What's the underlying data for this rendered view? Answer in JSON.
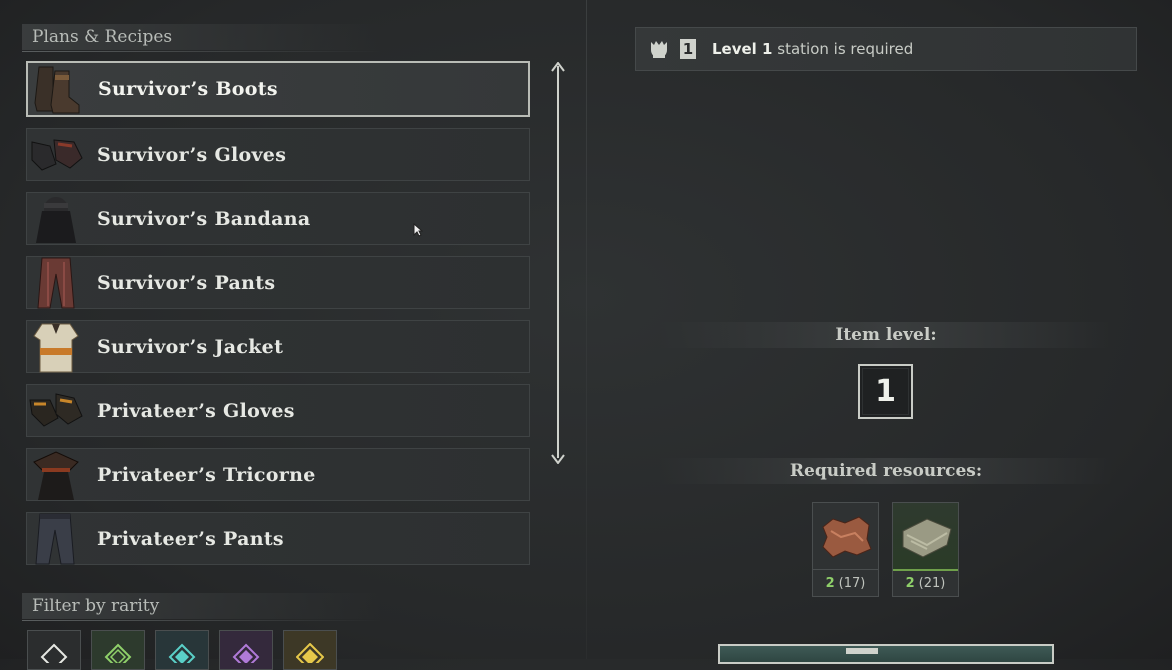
{
  "left_panel": {
    "plans_header": "Plans & Recipes",
    "recipes": [
      {
        "label": "Survivor’s Boots",
        "selected": true,
        "icon": "boots-icon"
      },
      {
        "label": "Survivor’s Gloves",
        "selected": false,
        "icon": "gloves-icon"
      },
      {
        "label": "Survivor’s Bandana",
        "selected": false,
        "icon": "bandana-icon"
      },
      {
        "label": "Survivor’s Pants",
        "selected": false,
        "icon": "pants-icon"
      },
      {
        "label": "Survivor’s Jacket",
        "selected": false,
        "icon": "jacket-icon"
      },
      {
        "label": "Privateer’s Gloves",
        "selected": false,
        "icon": "gloves-icon"
      },
      {
        "label": "Privateer’s Tricorne",
        "selected": false,
        "icon": "tricorne-hat-icon"
      },
      {
        "label": "Privateer’s Pants",
        "selected": false,
        "icon": "pants-icon"
      }
    ],
    "filter_header": "Filter by rarity",
    "rarity_filters": [
      "common",
      "uncommon",
      "rare",
      "epic",
      "legendary"
    ]
  },
  "right_panel": {
    "station_requirement": {
      "level_badge": "1",
      "level_text": "Level 1",
      "suffix_text": "station is required"
    },
    "item_level_label": "Item level:",
    "item_level_value": "1",
    "resources_label": "Required resources:",
    "resources": [
      {
        "name": "hide-icon",
        "required": "2",
        "owned": "(17)"
      },
      {
        "name": "cloth-icon",
        "required": "2",
        "owned": "(21)"
      }
    ]
  },
  "colors": {
    "background": "#2a2c2d",
    "selected_border": "#b9bcb6",
    "have_green": "#8fd06a",
    "craft_button": "#3f5a56"
  }
}
